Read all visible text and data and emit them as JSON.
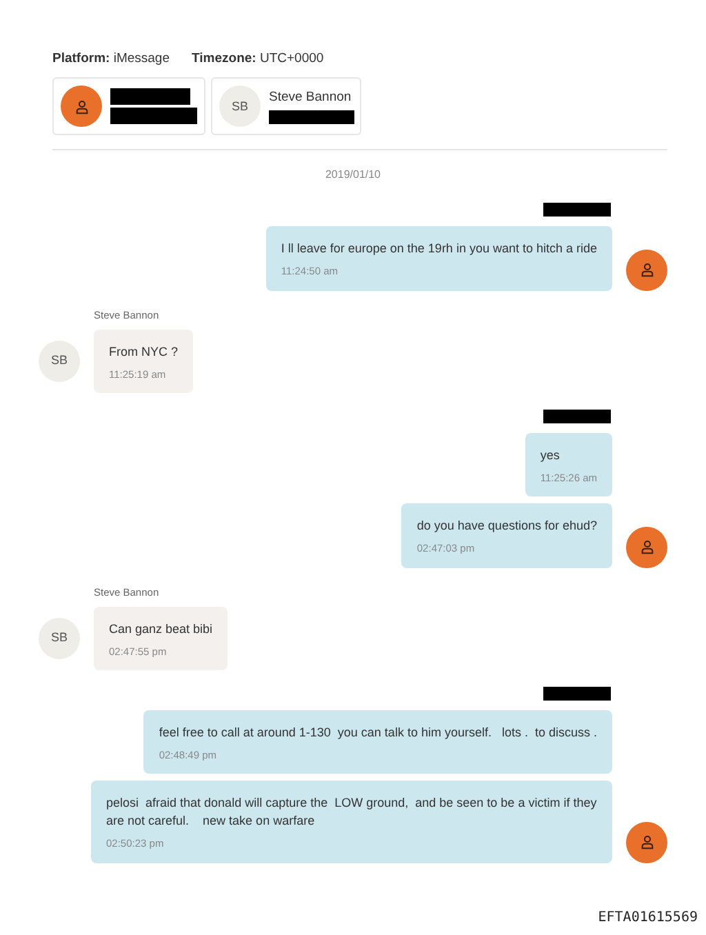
{
  "header": {
    "platform_label": "Platform:",
    "platform": "iMessage",
    "timezone_label": "Timezone:",
    "timezone": "UTC+0000"
  },
  "participants": [
    {
      "kind": "self",
      "redacted_name": true
    },
    {
      "kind": "contact",
      "initials": "SB",
      "name": "Steve Bannon",
      "redacted_detail": true
    }
  ],
  "date": "2019/01/10",
  "groups": [
    {
      "kind": "outgoing",
      "redacted_sender": true,
      "messages": [
        {
          "text": "I ll leave for europe on the 19rh in you want to hitch a ride",
          "time": "11:24:50 am"
        }
      ]
    },
    {
      "kind": "incoming",
      "sender": "Steve Bannon",
      "initials": "SB",
      "messages": [
        {
          "text": "From NYC ?",
          "time": "11:25:19 am"
        }
      ]
    },
    {
      "kind": "outgoing",
      "redacted_sender": true,
      "messages": [
        {
          "text": "yes",
          "time": "11:25:26 am"
        },
        {
          "text": "do you have questions for ehud?",
          "time": "02:47:03 pm"
        }
      ]
    },
    {
      "kind": "incoming",
      "sender": "Steve Bannon",
      "initials": "SB",
      "messages": [
        {
          "text": "Can ganz beat bibi",
          "time": "02:47:55 pm"
        }
      ]
    },
    {
      "kind": "outgoing",
      "redacted_sender": true,
      "messages": [
        {
          "text": "feel free to call at around 1-130  you can talk to him yourself.   lots .  to discuss .",
          "time": "02:48:49 pm"
        },
        {
          "text": "pelosi  afraid that donald will capture the  LOW ground,  and be seen to be a victim if they are not careful.    new take on warfare",
          "time": "02:50:23 pm"
        }
      ]
    }
  ],
  "footer": "EFTA01615569"
}
